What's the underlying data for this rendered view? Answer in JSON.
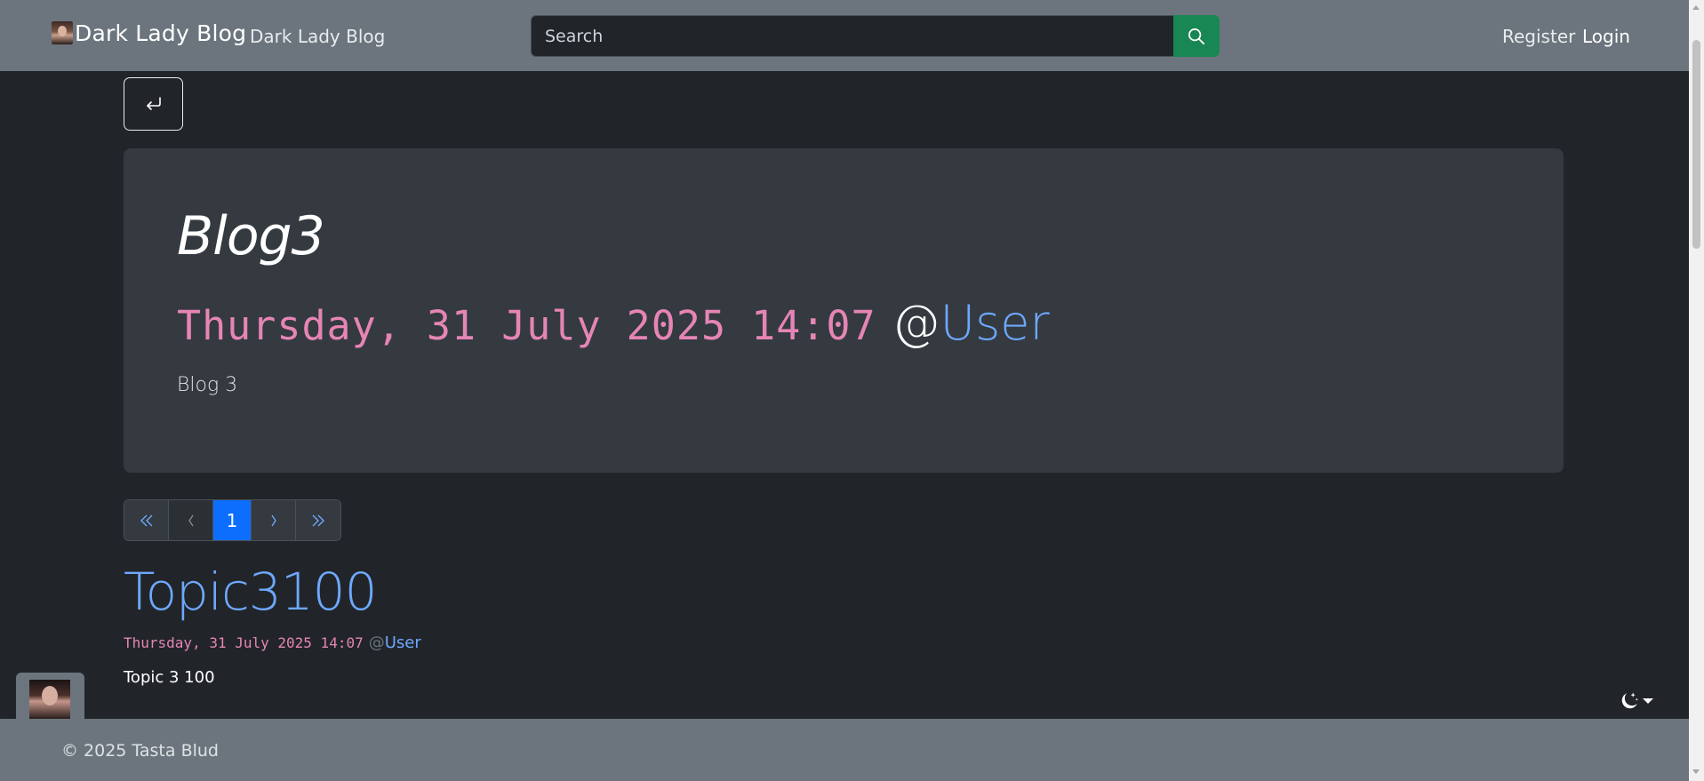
{
  "navbar": {
    "brand_text": "Dark Lady Blog",
    "nav_link": "Dark Lady Blog",
    "search_placeholder": "Search",
    "search_value": "",
    "register_label": "Register",
    "login_label": "Login",
    "search_button_color": "#198754"
  },
  "blog": {
    "title": "Blog3",
    "date": "Thursday, 31 July 2025 14:07",
    "at": "@",
    "user": "User",
    "description": "Blog 3"
  },
  "pagination": {
    "first": "«",
    "prev": "‹",
    "current": "1",
    "next": "›",
    "last": "»"
  },
  "topics": [
    {
      "title": "Topic3100",
      "date": "Thursday, 31 July 2025 14:07",
      "at": "@",
      "user": "User",
      "body": "Topic 3 100"
    }
  ],
  "footer": {
    "text": "© 2025 Tasta Blud"
  },
  "icons": {
    "back": "return-arrow-icon",
    "search": "search-icon",
    "theme": "moon-stars-icon"
  },
  "colors": {
    "navbar_bg": "#6c757d",
    "page_bg": "#212529",
    "card_bg": "#343a40",
    "date_pink": "#e685b5",
    "link_blue": "#6ea8fe",
    "active_page": "#0d6efd"
  }
}
